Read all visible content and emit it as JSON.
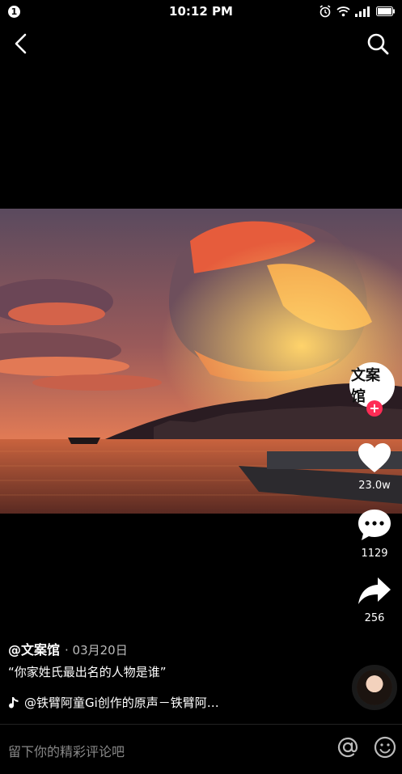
{
  "status": {
    "time": "10:12 PM",
    "notification_badge": "1"
  },
  "header": {
    "back_icon": "chevron-left-icon",
    "search_icon": "search-icon"
  },
  "creator": {
    "avatar_text": "文案馆"
  },
  "actions": {
    "likes": "23.0w",
    "comments": "1129",
    "shares": "256"
  },
  "post": {
    "author": "@文案馆",
    "date": "· 03月20日",
    "caption": "“你家姓氏最出名的人物是谁”",
    "music": "@铁臂阿童Gi创作的原声－铁臂阿…"
  },
  "comment_bar": {
    "placeholder": "留下你的精彩评论吧"
  },
  "colors": {
    "accent": "#fe2c55",
    "background": "#000000"
  }
}
